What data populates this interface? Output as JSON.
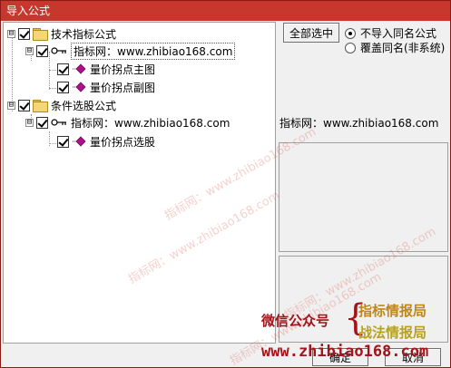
{
  "window": {
    "title": "导入公式"
  },
  "tree": {
    "group1": {
      "label": "技术指标公式",
      "source": {
        "label": "指标网：www.zhibiao168.com",
        "items": [
          {
            "label": "量价拐点主图"
          },
          {
            "label": "量价拐点副图"
          }
        ]
      }
    },
    "group2": {
      "label": "条件选股公式",
      "source": {
        "label": "指标网：www.zhibiao168.com",
        "items": [
          {
            "label": "量价拐点选股"
          }
        ]
      }
    },
    "expander_symbol": "⊟"
  },
  "controls": {
    "select_all_label": "全部选中",
    "radio_no_import": "不导入同名公式",
    "radio_overwrite": "覆盖同名(非系统)",
    "selected_radio": "no_import"
  },
  "info": {
    "source_text": "指标网：www.zhibiao168.com"
  },
  "buttons": {
    "ok_label": "确定",
    "cancel_label": "取消"
  },
  "overlay": {
    "watermark_text": "指标网：www.zhibiao168.com",
    "wechat_label": "微信公众号",
    "promo_line1": "指标情报局",
    "promo_line2": "战法情报局",
    "promo_url": "www.zhibiao168.com"
  },
  "colors": {
    "titlebar": "#c8372e",
    "promo_red": "#a3141a",
    "promo_orange": "#c0861a",
    "promo_yellow": "#b8a11e",
    "formula_icon": "#b0108c"
  }
}
